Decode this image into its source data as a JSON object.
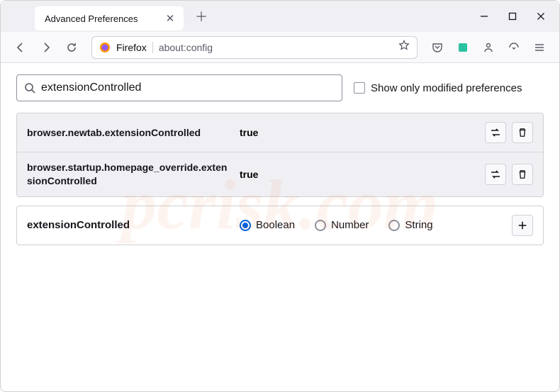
{
  "tab": {
    "title": "Advanced Preferences"
  },
  "urlbar": {
    "brand": "Firefox",
    "url": "about:config"
  },
  "search": {
    "value": "extensionControlled"
  },
  "checkbox": {
    "label": "Show only modified preferences"
  },
  "prefs": [
    {
      "name": "browser.newtab.extensionControlled",
      "value": "true"
    },
    {
      "name": "browser.startup.homepage_override.extensionControlled",
      "value": "true"
    }
  ],
  "newPref": {
    "name": "extensionControlled",
    "types": {
      "boolean": "Boolean",
      "number": "Number",
      "string": "String"
    },
    "selected": "boolean"
  },
  "watermark": "pcrisk.com"
}
